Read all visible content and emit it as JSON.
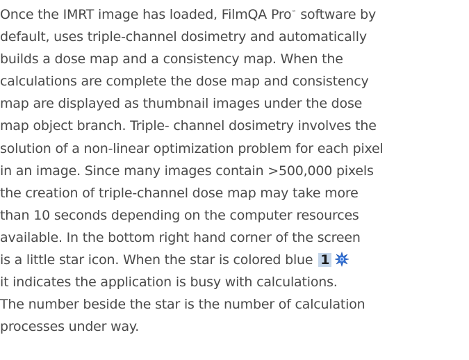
{
  "document": {
    "line1_before_tm": "Once the IMRT image has loaded, FilmQA Pro",
    "trademark": "™",
    "line1_after_tm": " software by",
    "lines": [
      "default, uses triple-channel dosimetry and automatically",
      "builds a dose map and a consistency map. When the",
      "calculations are complete the dose map and consistency",
      "map are displayed as thumbnail images under the dose",
      "map object branch. Triple- channel dosimetry involves the",
      "solution of a non-linear optimization problem for each pixel",
      "in an image. Since many images contain >500,000 pixels",
      "the creation of triple-channel dose map may take more",
      "than 10 seconds depending on the computer resources",
      "available. In the bottom right hand corner of the screen"
    ],
    "star_line_text": "is a little star icon. When the star is colored blue",
    "busy_count": "1",
    "busy_icon": "blue-star-busy-icon",
    "busy_icon_color": "#2f6fd6",
    "after_lines": [
      "it indicates the application is busy with calculations.",
      "The number beside the star is the number of calculation",
      "processes under way."
    ]
  }
}
